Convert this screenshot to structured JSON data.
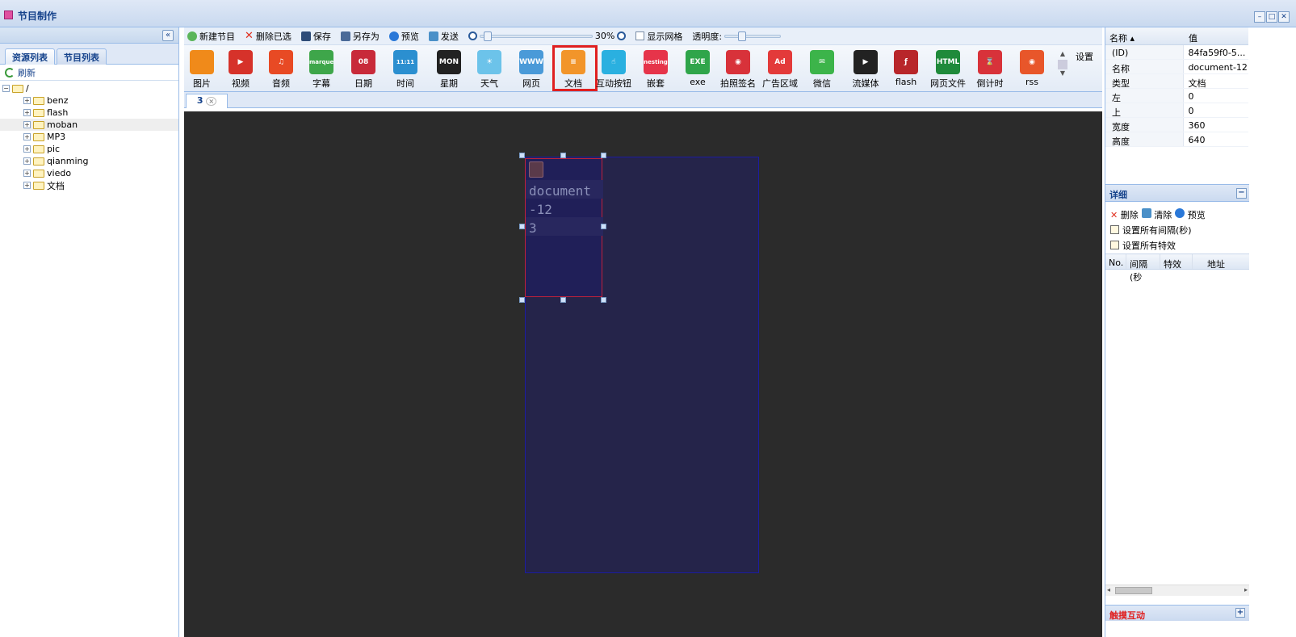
{
  "window": {
    "title": "节目制作",
    "controls": [
      "–",
      "□",
      "✕"
    ]
  },
  "left": {
    "collapse_glyph": "«",
    "tabs": [
      "资源列表",
      "节目列表"
    ],
    "refresh": "刷新",
    "root": "/",
    "folders": [
      "benz",
      "flash",
      "moban",
      "MP3",
      "pic",
      "qianming",
      "viedo",
      "文档"
    ]
  },
  "toolbar": {
    "new": "新建节目",
    "delete": "删除已选",
    "save": "保存",
    "save_as": "另存为",
    "preview": "预览",
    "send": "发送",
    "zoom": "30%",
    "show_grid": "显示网格",
    "opacity": "透明度:"
  },
  "widgets": [
    {
      "label": "图片",
      "glyph": "",
      "color": "#f08a1a",
      "icon": "picture-icon"
    },
    {
      "label": "视频",
      "glyph": "▶",
      "color": "#d6322a",
      "icon": "video-icon"
    },
    {
      "label": "音频",
      "glyph": "♫",
      "color": "#e84a24",
      "icon": "audio-icon"
    },
    {
      "label": "字幕",
      "glyph": "marquee",
      "color": "#3ea64a",
      "icon": "marquee-icon"
    },
    {
      "label": "日期",
      "glyph": "08",
      "color": "#c82a3a",
      "icon": "date-icon"
    },
    {
      "label": "时间",
      "glyph": "11:11",
      "color": "#2b8fd0",
      "icon": "time-icon"
    },
    {
      "label": "星期",
      "glyph": "MON",
      "color": "#222222",
      "icon": "weekday-icon"
    },
    {
      "label": "天气",
      "glyph": "☀",
      "color": "#6cc3ea",
      "icon": "weather-icon"
    },
    {
      "label": "网页",
      "glyph": "WWW",
      "color": "#4a9ad8",
      "icon": "webpage-icon"
    },
    {
      "label": "文档",
      "glyph": "≡",
      "color": "#f2952a",
      "icon": "document-icon"
    },
    {
      "label": "互动按钮",
      "glyph": "☝",
      "color": "#2ab0e0",
      "icon": "interactive-button-icon"
    },
    {
      "label": "嵌套",
      "glyph": "nesting",
      "color": "#e6344a",
      "icon": "nesting-icon"
    },
    {
      "label": "exe",
      "glyph": "EXE",
      "color": "#2fa54a",
      "icon": "exe-icon"
    },
    {
      "label": "拍照签名",
      "glyph": "◉",
      "color": "#d8323a",
      "icon": "photo-sign-icon"
    },
    {
      "label": "广告区域",
      "glyph": "Ad",
      "color": "#e33a3a",
      "icon": "ad-area-icon"
    },
    {
      "label": "微信",
      "glyph": "✉",
      "color": "#3cb44a",
      "icon": "wechat-icon"
    },
    {
      "label": "流媒体",
      "glyph": "▶",
      "color": "#222222",
      "icon": "stream-icon"
    },
    {
      "label": "flash",
      "glyph": "ƒ",
      "color": "#b8262a",
      "icon": "flash-icon"
    },
    {
      "label": "网页文件",
      "glyph": "HTML",
      "color": "#1f8a3a",
      "icon": "html-file-icon"
    },
    {
      "label": "倒计时",
      "glyph": "⌛",
      "color": "#d8323a",
      "icon": "countdown-icon"
    },
    {
      "label": "rss",
      "glyph": "◉",
      "color": "#e8562a",
      "icon": "rss-icon"
    }
  ],
  "settings_label": "设置",
  "doc_tab": {
    "label": "3",
    "close": "×"
  },
  "canvas": {
    "element_text": "document\n-12\n3"
  },
  "properties": {
    "header_name": "名称 ▴",
    "header_value": "值",
    "rows": [
      {
        "k": "(ID)",
        "v": "84fa59f0-5..."
      },
      {
        "k": "名称",
        "v": "document-12"
      },
      {
        "k": "类型",
        "v": "文档"
      },
      {
        "k": "左",
        "v": "0"
      },
      {
        "k": "上",
        "v": "0"
      },
      {
        "k": "宽度",
        "v": "360"
      },
      {
        "k": "高度",
        "v": "640"
      }
    ]
  },
  "detail": {
    "title": "详细",
    "delete": "删除",
    "clear": "清除",
    "preview": "预览",
    "set_interval": "设置所有间隔(秒)",
    "set_effect": "设置所有特效",
    "columns": [
      "No.",
      "间隔(秒",
      "特效",
      "地址"
    ]
  },
  "touch": {
    "title": "触摸互动"
  }
}
